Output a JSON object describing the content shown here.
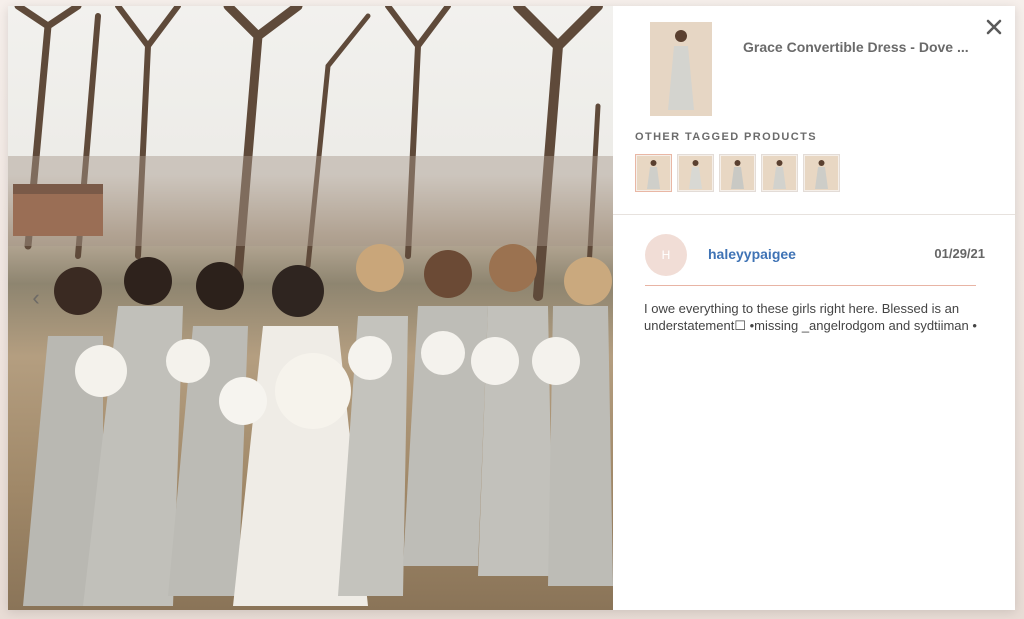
{
  "modal": {
    "product": {
      "title": "Grace Convertible Dress - Dove ...",
      "thumbnail_icon": "dress-thumbnail"
    },
    "other_tagged_products": {
      "label": "OTHER TAGGED PRODUCTS",
      "count": 5,
      "active_index": 0
    },
    "post": {
      "avatar_initial": "H",
      "username": "haleyypaigee",
      "date": "01/29/21",
      "caption": "I owe everything to these girls right here. Blessed is an understatement☐ •missing _angelrodgom and sydtiiman •"
    },
    "photo": {
      "prev_arrow": "‹"
    },
    "close_icon": "close-icon",
    "colors": {
      "accent": "#3f73b5",
      "rule": "#e8b4a4",
      "avatar": "#f1ddd6"
    }
  }
}
